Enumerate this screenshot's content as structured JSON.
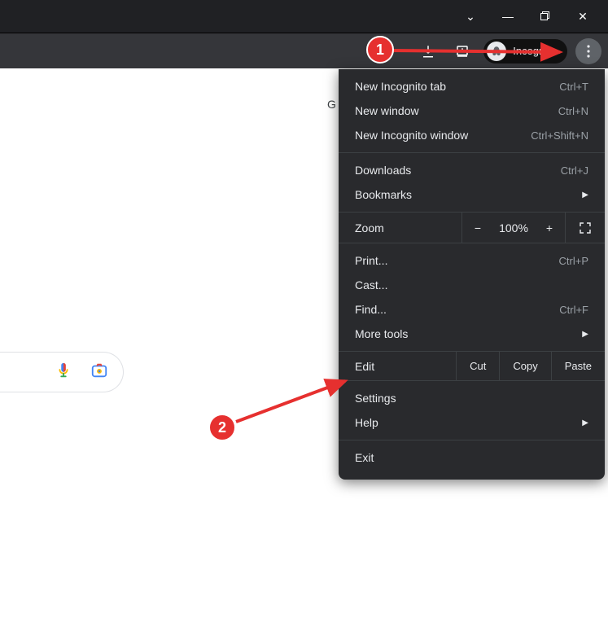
{
  "window": {
    "chevron": "⌄",
    "minimize": "—",
    "maximize": "❐",
    "close": "✕"
  },
  "toolbar": {
    "incognito_label": "Incognito"
  },
  "page": {
    "g": "G"
  },
  "menu": {
    "section1": [
      {
        "label": "New Incognito tab",
        "shortcut": "Ctrl+T"
      },
      {
        "label": "New window",
        "shortcut": "Ctrl+N"
      },
      {
        "label": "New Incognito window",
        "shortcut": "Ctrl+Shift+N"
      }
    ],
    "section2": [
      {
        "label": "Downloads",
        "shortcut": "Ctrl+J"
      },
      {
        "label": "Bookmarks",
        "submenu": true
      }
    ],
    "zoom": {
      "label": "Zoom",
      "minus": "−",
      "value": "100%",
      "plus": "+"
    },
    "section3": [
      {
        "label": "Print...",
        "shortcut": "Ctrl+P"
      },
      {
        "label": "Cast..."
      },
      {
        "label": "Find...",
        "shortcut": "Ctrl+F"
      },
      {
        "label": "More tools",
        "submenu": true
      }
    ],
    "edit": {
      "label": "Edit",
      "cut": "Cut",
      "copy": "Copy",
      "paste": "Paste"
    },
    "section4": [
      {
        "label": "Settings"
      },
      {
        "label": "Help",
        "submenu": true
      }
    ],
    "section5": [
      {
        "label": "Exit"
      }
    ]
  },
  "annotations": {
    "badge1": "1",
    "badge2": "2"
  }
}
